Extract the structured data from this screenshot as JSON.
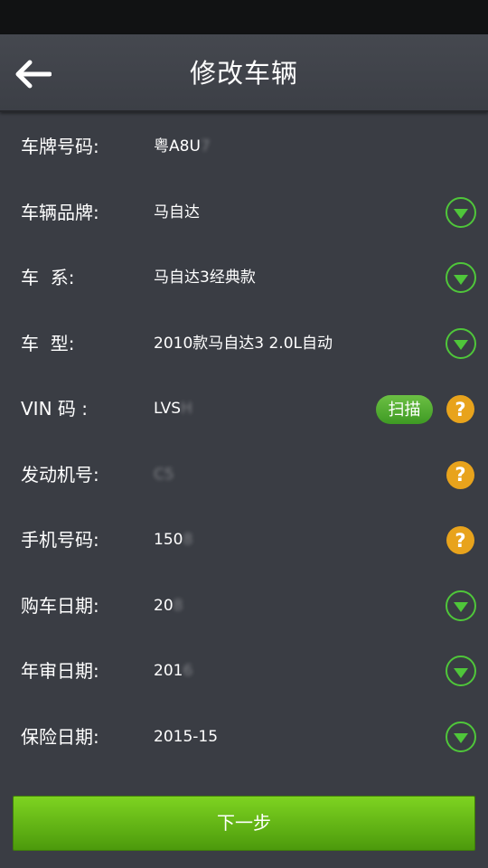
{
  "header": {
    "title": "修改车辆"
  },
  "form": {
    "plate_number": {
      "label": "车牌号码:",
      "value": "粤A8U",
      "value_obscured": "7"
    },
    "brand": {
      "label": "车辆品牌:",
      "value": "马自达"
    },
    "series": {
      "label": "车  系:",
      "value": "马自达3经典款"
    },
    "model": {
      "label": "车  型:",
      "value": "2010款马自达3 2.0L自动"
    },
    "vin": {
      "label": "VIN 码 :",
      "value": "LVS",
      "value_obscured": "H",
      "scan_label": "扫描"
    },
    "engine_number": {
      "label": "发动机号:",
      "value": "",
      "value_obscured": "C5"
    },
    "phone": {
      "label": "手机号码:",
      "value": "150",
      "value_obscured": "8"
    },
    "purchase_date": {
      "label": "购车日期:",
      "value": "20",
      "value_obscured": "8"
    },
    "inspection_date": {
      "label": "年审日期:",
      "value": "201",
      "value_obscured": "6"
    },
    "insurance_date": {
      "label": "保险日期:",
      "value": "201",
      "value_obscured": "5-15"
    }
  },
  "footer": {
    "next_label": "下一步"
  },
  "colors": {
    "accent_green": "#4fc63a",
    "help_orange": "#e8a31c",
    "button_green": "#7ed321",
    "background": "#3a3d44"
  }
}
